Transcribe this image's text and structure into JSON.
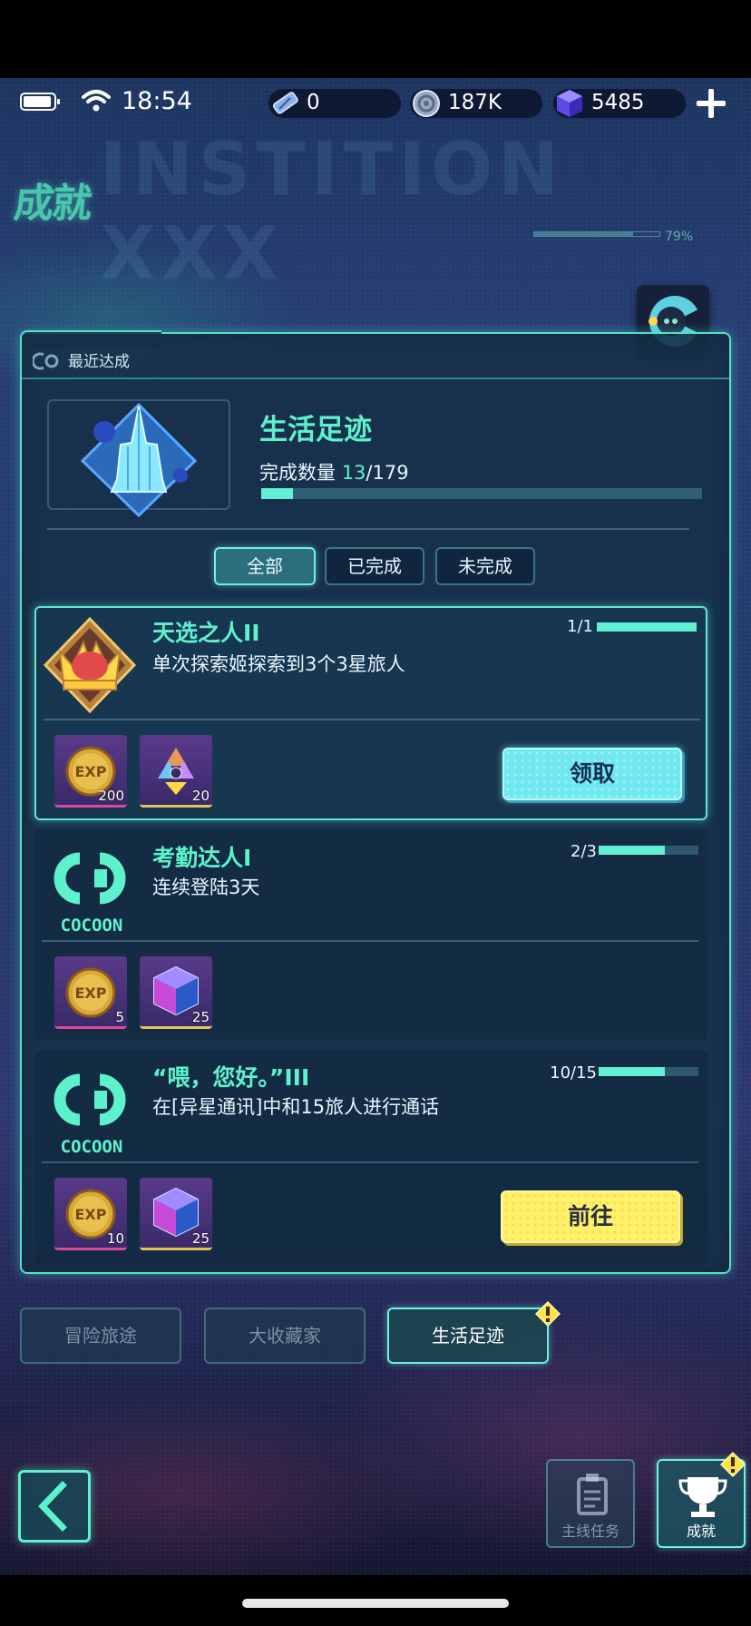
{
  "status_bar": {
    "time": "18:54",
    "resources": [
      {
        "name": "ticket",
        "value": "0"
      },
      {
        "name": "coin",
        "value": "187K"
      },
      {
        "name": "gem",
        "value": "5485"
      }
    ]
  },
  "header": {
    "title": "成就",
    "progress_text": "79%"
  },
  "panel": {
    "recent_label": "最近达成",
    "category_title": "生活足迹",
    "done_label": "完成数量",
    "done_count": "13",
    "done_total": "/179",
    "done_fraction": 0.0726
  },
  "filters": [
    {
      "label": "全部",
      "active": true
    },
    {
      "label": "已完成",
      "active": false
    },
    {
      "label": "未完成",
      "active": false
    }
  ],
  "achievements": [
    {
      "title": "天选之人II",
      "desc": "单次探索姬探索到3个3星旅人",
      "progress_text": "1/1",
      "progress": 1.0,
      "icon": "crown-icon",
      "rewards": [
        {
          "icon": "exp-coin-icon",
          "count": "200"
        },
        {
          "icon": "tri-crystal-icon",
          "count": "20"
        }
      ],
      "action": "领取"
    },
    {
      "title": "考勤达人I",
      "desc": "连续登陆3天",
      "progress_text": "2/3",
      "progress": 0.6667,
      "icon": "cocoon-logo-icon",
      "logo_text": "COCOON",
      "rewards": [
        {
          "icon": "exp-coin-icon",
          "count": "5"
        },
        {
          "icon": "gem-cube-icon",
          "count": "25"
        }
      ],
      "action": ""
    },
    {
      "title": "“喂，您好。”III",
      "desc": "在[异星通讯]中和15旅人进行通话",
      "progress_text": "10/15",
      "progress": 0.6667,
      "icon": "cocoon-logo-icon",
      "logo_text": "COCOON",
      "rewards": [
        {
          "icon": "exp-coin-icon",
          "count": "10"
        },
        {
          "icon": "gem-cube-icon",
          "count": "25"
        }
      ],
      "action": "前往"
    }
  ],
  "bottom_tabs": [
    {
      "label": "冒险旅途",
      "active": false
    },
    {
      "label": "大收藏家",
      "active": false
    },
    {
      "label": "生活足迹",
      "active": true
    }
  ],
  "nav": {
    "main_task": "主线任务",
    "achievement": "成就"
  },
  "colors": {
    "accent": "#5ef2cc",
    "panel_border": "#52e3c9",
    "claim": "#6fe8f0",
    "go": "#fff26a"
  }
}
